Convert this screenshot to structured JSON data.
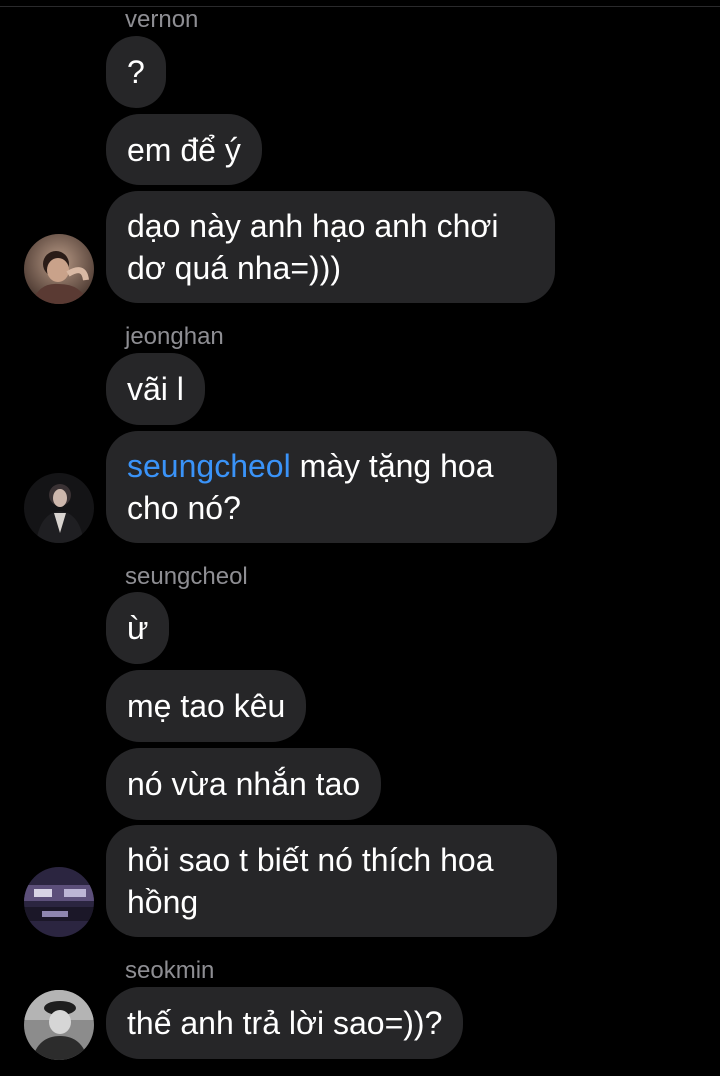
{
  "messages": [
    {
      "sender": "vernon",
      "bubbles": [
        "?",
        "em để ý",
        [
          "dạo này anh hạo anh chơi",
          "dơ quá nha=)))"
        ]
      ]
    },
    {
      "sender": "jeonghan",
      "bubbles": [
        "vãi l"
      ],
      "mention_bubble": {
        "mention": "seungcheol",
        "line1_rest": " mày tặng hoa",
        "line2": "cho nó?"
      }
    },
    {
      "sender": "seungcheol",
      "bubbles": [
        "ừ",
        "mẹ tao kêu",
        "nó vừa nhắn tao",
        [
          "hỏi sao t biết nó thích hoa",
          "hồng"
        ]
      ]
    },
    {
      "sender": "seokmin",
      "bubbles": [
        "thế anh trả lời sao=))?"
      ]
    }
  ],
  "colors": {
    "background": "#000000",
    "bubble": "#262628",
    "sender_name": "#8e8e93",
    "mention": "#3a93f8",
    "text": "#ffffff"
  },
  "icons": {
    "avatar_vernon": "avatar-photo",
    "avatar_jeonghan": "avatar-photo",
    "avatar_seungcheol": "avatar-photo",
    "avatar_seokmin": "avatar-photo"
  }
}
